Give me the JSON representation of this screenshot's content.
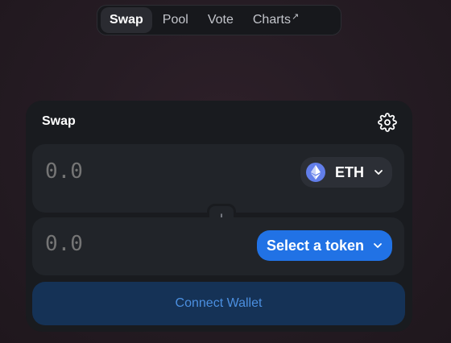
{
  "nav": {
    "items": [
      {
        "label": "Swap",
        "active": true
      },
      {
        "label": "Pool",
        "active": false
      },
      {
        "label": "Vote",
        "active": false
      },
      {
        "label": "Charts",
        "active": false
      }
    ],
    "external_icon": "↗"
  },
  "swap": {
    "title": "Swap",
    "settings_icon": "gear-icon",
    "input": {
      "amount_placeholder": "0.0",
      "token_symbol": "ETH",
      "token_icon": "ethereum-icon"
    },
    "switch_icon": "arrow-down-icon",
    "output": {
      "amount_placeholder": "0.0",
      "select_label": "Select a token"
    },
    "connect_label": "Connect Wallet"
  },
  "colors": {
    "accent": "#2172e5",
    "connect_bg": "#153256",
    "connect_text": "#4b8fe0",
    "eth": "#627eea"
  }
}
